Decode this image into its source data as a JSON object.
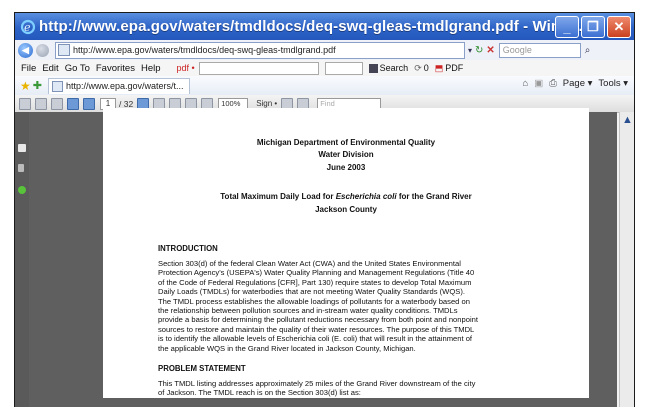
{
  "window": {
    "title": "http://www.epa.gov/waters/tmdldocs/deq-swq-gleas-tmdlgrand.pdf - Windo...",
    "buttons": {
      "minimize": "_",
      "maximize": "❐",
      "close": "✕"
    }
  },
  "address_bar": {
    "url": "http://www.epa.gov/waters/tmdldocs/deq-swq-gleas-tmdlgrand.pdf",
    "search_placeholder": "Google"
  },
  "menu": {
    "items": [
      "File",
      "Edit",
      "Go To",
      "Favorites",
      "Help"
    ],
    "pdf_label": "pdf •",
    "search_label": "Search",
    "count": "0",
    "pdf_tool": "PDF"
  },
  "favorites": {
    "tab_label": "http://www.epa.gov/waters/t...",
    "page_menu": "Page ▾",
    "tools_menu": "Tools ▾"
  },
  "pdf_toolbar": {
    "current_page": "1",
    "total_pages": "/ 32",
    "zoom": "100%",
    "sign_label": "Sign •",
    "find_placeholder": "Find"
  },
  "document": {
    "heading1": "Michigan Department of Environmental Quality",
    "heading2": "Water Division",
    "heading3": "June 2003",
    "title_line1_a": "Total Maximum Daily Load for ",
    "title_line1_italic": "Escherichia coli",
    "title_line1_b": " for the Grand River",
    "title_line2": "Jackson County",
    "intro_heading": "INTRODUCTION",
    "intro_lines": [
      "Section 303(d) of the federal Clean Water Act (CWA) and the United States Environmental",
      "Protection Agency's (USEPA's) Water Quality Planning and Management Regulations (Title 40",
      "of the Code of Federal Regulations [CFR], Part 130) require states to develop Total Maximum",
      "Daily Loads (TMDLs) for waterbodies that are not meeting Water Quality Standards (WQS).",
      "The TMDL process establishes the allowable loadings of pollutants for a waterbody based on",
      "the relationship between pollution sources and in-stream water quality conditions.  TMDLs",
      "provide a basis for determining the pollutant reductions necessary from both point and nonpoint",
      "sources to restore and maintain the quality of their water resources.  The purpose of this TMDL",
      "is to identify the allowable levels of Escherichia coli (E. coli) that will result in the attainment of",
      "the applicable WQS in the Grand River located in Jackson County, Michigan."
    ],
    "problem_heading": "PROBLEM STATEMENT",
    "problem_lines": [
      "This TMDL listing addresses approximately 25 miles of the Grand River downstream of the city",
      "of Jackson.  The TMDL reach is on the Section 303(d) list as:"
    ]
  }
}
